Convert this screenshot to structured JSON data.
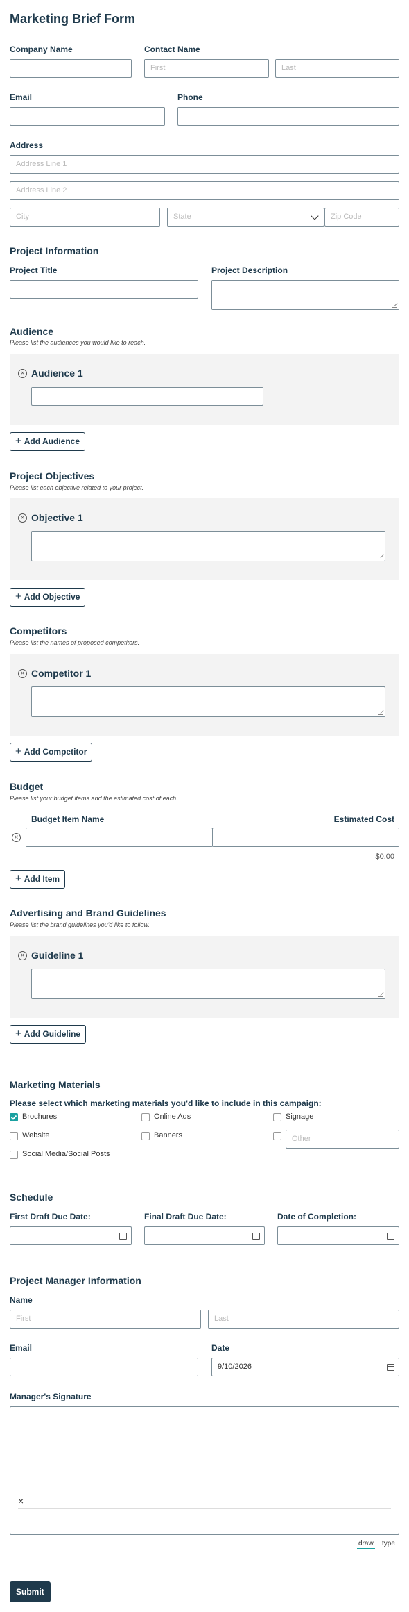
{
  "title": "Marketing Brief Form",
  "company": {
    "label": "Company Name"
  },
  "contact": {
    "label": "Contact Name",
    "first_ph": "First",
    "last_ph": "Last"
  },
  "email": {
    "label": "Email"
  },
  "phone": {
    "label": "Phone"
  },
  "address": {
    "label": "Address",
    "line1_ph": "Address Line 1",
    "line2_ph": "Address Line 2",
    "city_ph": "City",
    "state_ph": "State",
    "zip_ph": "Zip Code"
  },
  "project_info": {
    "heading": "Project Information",
    "title_label": "Project Title",
    "desc_label": "Project Description"
  },
  "audience": {
    "heading": "Audience",
    "subtitle": "Please list the audiences you would like to reach.",
    "item_title": "Audience 1",
    "add_label": "Add Audience"
  },
  "objectives": {
    "heading": "Project Objectives",
    "subtitle": "Please list each objective related to your project.",
    "item_title": "Objective 1",
    "add_label": "Add Objective"
  },
  "competitors": {
    "heading": "Competitors",
    "subtitle": "Please list the names of proposed competitors.",
    "item_title": "Competitor 1",
    "add_label": "Add Competitor"
  },
  "budget": {
    "heading": "Budget",
    "subtitle": "Please list your budget items and the estimated cost of each.",
    "col_name": "Budget Item Name",
    "col_cost": "Estimated Cost",
    "total": "$0.00",
    "add_label": "Add Item"
  },
  "guidelines": {
    "heading": "Advertising and Brand Guidelines",
    "subtitle": "Please list the brand guidelines you'd like to follow.",
    "item_title": "Guideline 1",
    "add_label": "Add Guideline"
  },
  "materials": {
    "heading": "Marketing Materials",
    "prompt": "Please select which marketing materials you'd like to include in this campaign:",
    "options": [
      {
        "label": "Brochures",
        "checked": true
      },
      {
        "label": "Online Ads",
        "checked": false
      },
      {
        "label": "Signage",
        "checked": false
      },
      {
        "label": "Website",
        "checked": false
      },
      {
        "label": "Banners",
        "checked": false
      },
      {
        "label": "Social Media/Social Posts",
        "checked": false
      }
    ],
    "other_ph": "Other"
  },
  "schedule": {
    "heading": "Schedule",
    "first_label": "First Draft Due Date:",
    "final_label": "Final Draft Due Date:",
    "completion_label": "Date of Completion:"
  },
  "manager": {
    "heading": "Project Manager Information",
    "name_label": "Name",
    "first_ph": "First",
    "last_ph": "Last",
    "email_label": "Email",
    "date_label": "Date",
    "date_value": "9/10/2026",
    "signature_label": "Manager's Signature",
    "sig_x": "×",
    "tab_draw": "draw",
    "tab_type": "type"
  },
  "submit_label": "Submit",
  "colors": {
    "primary": "#1f3a4c",
    "accent": "#1aa0a0",
    "panel": "#f3f3f3"
  }
}
